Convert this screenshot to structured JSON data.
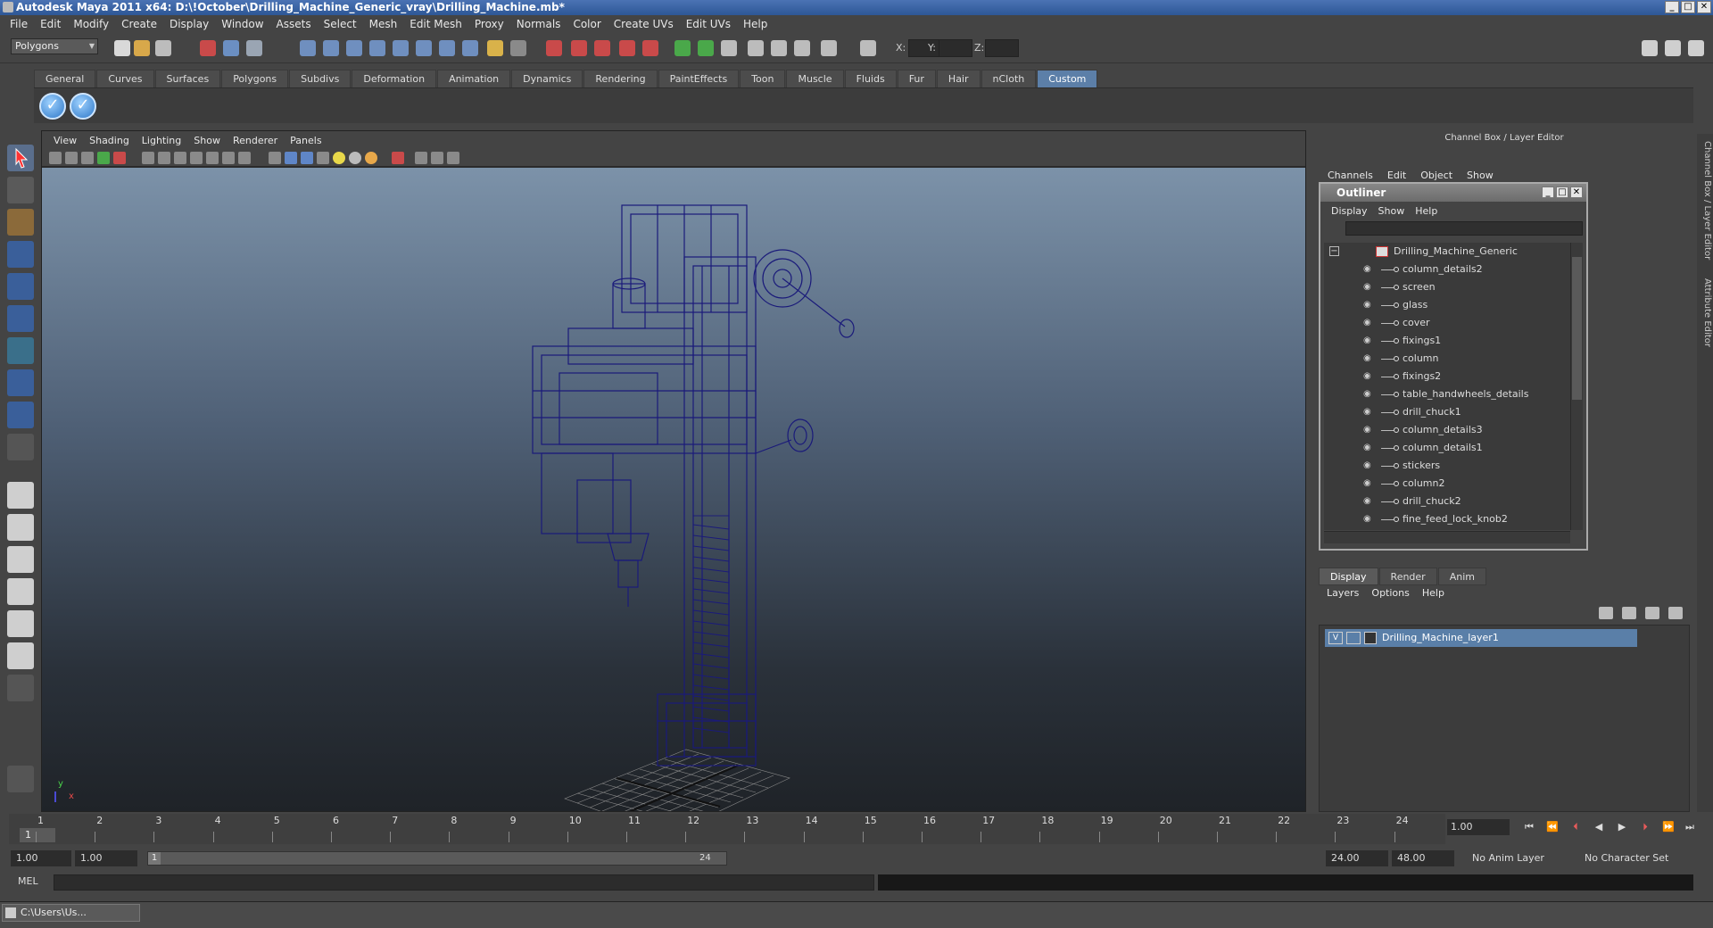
{
  "window": {
    "title": "Autodesk Maya 2011 x64: D:\\!October\\Drilling_Machine_Generic_vray\\Drilling_Machine.mb*",
    "min": "_",
    "max": "□",
    "close": "✕"
  },
  "menubar": [
    "File",
    "Edit",
    "Modify",
    "Create",
    "Display",
    "Window",
    "Assets",
    "Select",
    "Mesh",
    "Edit Mesh",
    "Proxy",
    "Normals",
    "Color",
    "Create UVs",
    "Edit UVs",
    "Help"
  ],
  "statusline": {
    "mode": "Polygons",
    "x_label": "X:",
    "y_label": "Y:",
    "z_label": "Z:"
  },
  "shelf": {
    "tabs": [
      "General",
      "Curves",
      "Surfaces",
      "Polygons",
      "Subdivs",
      "Deformation",
      "Animation",
      "Dynamics",
      "Rendering",
      "PaintEffects",
      "Toon",
      "Muscle",
      "Fluids",
      "Fur",
      "Hair",
      "nCloth",
      "Custom"
    ],
    "active_tab": "Custom",
    "btn_glyph": "✓"
  },
  "viewport": {
    "menu": [
      "View",
      "Shading",
      "Lighting",
      "Show",
      "Renderer",
      "Panels"
    ],
    "axis_y": "y",
    "axis_x": "x"
  },
  "channelbox": {
    "title": "Channel Box / Layer Editor",
    "menu": [
      "Channels",
      "Edit",
      "Object",
      "Show"
    ]
  },
  "outliner": {
    "title": "Outliner",
    "menu": [
      "Display",
      "Show",
      "Help"
    ],
    "collapse": "−",
    "root": "Drilling_Machine_Generic",
    "items": [
      "column_details2",
      "screen",
      "glass",
      "cover",
      "fixings1",
      "column",
      "fixings2",
      "table_handwheels_details",
      "drill_chuck1",
      "column_details3",
      "column_details1",
      "stickers",
      "column2",
      "drill_chuck2",
      "fine_feed_lock_knob2"
    ]
  },
  "layer_editor": {
    "tabs": [
      "Display",
      "Render",
      "Anim"
    ],
    "active_tab": "Display",
    "menu": [
      "Layers",
      "Options",
      "Help"
    ],
    "visible_flag": "V",
    "layer_name": "Drilling_Machine_layer1"
  },
  "side_tabs": [
    "Channel Box / Layer Editor",
    "Attribute Editor"
  ],
  "timeslider": {
    "ticks": [
      "1",
      "2",
      "3",
      "4",
      "5",
      "6",
      "7",
      "8",
      "9",
      "10",
      "11",
      "12",
      "13",
      "14",
      "15",
      "16",
      "17",
      "18",
      "19",
      "20",
      "21",
      "22",
      "23",
      "24"
    ],
    "current": "1",
    "current_field": "1.00",
    "controls": [
      "⏮",
      "⏪",
      "⏴",
      "◀",
      "▶",
      "⏵",
      "⏩",
      "⏭"
    ]
  },
  "rangeslider": {
    "start": "1.00",
    "playback_start": "1.00",
    "range_start": "1",
    "range_end": "24",
    "playback_end": "24.00",
    "end": "48.00",
    "anim_layer": "No Anim Layer",
    "character_set": "No Character Set"
  },
  "cmdline": {
    "label": "MEL"
  },
  "taskbar": {
    "item": "C:\\Users\\Us..."
  },
  "colors": {
    "wireframe": "#1a1a7a",
    "accent": "#5a7fa8"
  }
}
